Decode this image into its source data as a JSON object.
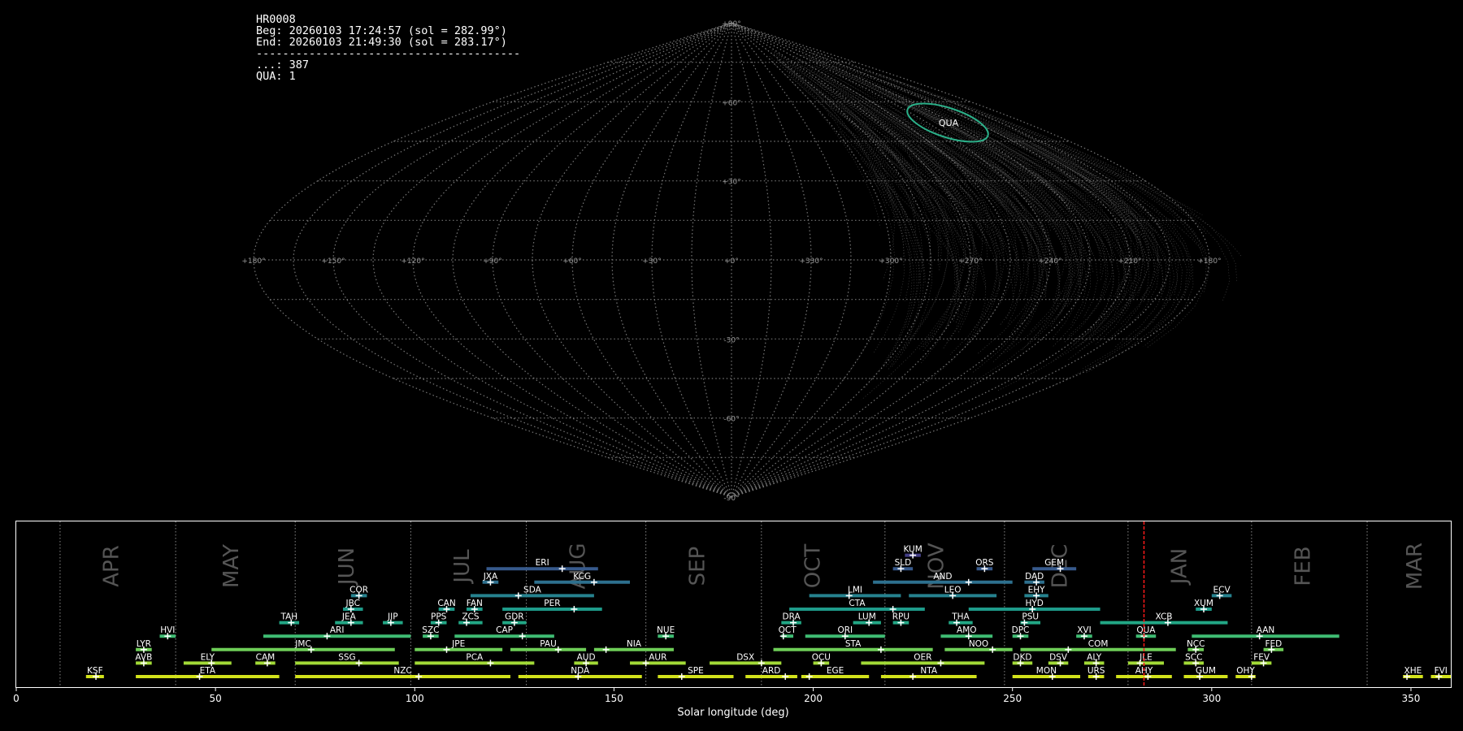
{
  "info": {
    "station": "HR0008",
    "beg": "Beg: 20260103 17:24:57 (sol = 282.99°)",
    "end": "End: 20260103 21:49:30 (sol = 283.17°)",
    "separator": "----------------------------------------",
    "count": "...: 387",
    "qua": "QUA: 1"
  },
  "sky_map": {
    "projection": "sinusoidal",
    "lon_labels": [
      "+180°",
      "+150°",
      "+120°",
      "+90°",
      "+60°",
      "+30°",
      "+0°",
      "+330°",
      "+300°",
      "+270°",
      "+240°",
      "+210°",
      "+180°"
    ],
    "lat_labels": [
      "+90°",
      "+60°",
      "+30°",
      "-30°",
      "-60°",
      "-90°"
    ],
    "grid_color": "#777777",
    "highlight": {
      "label": "QUA",
      "color": "#2bb089"
    }
  },
  "chart_data": {
    "type": "gantt",
    "xlabel": "Solar longitude (deg)",
    "xlim": [
      0,
      360
    ],
    "xticks": [
      0,
      50,
      100,
      150,
      200,
      250,
      300,
      350
    ],
    "months": [
      {
        "name": "APR",
        "lon": 24
      },
      {
        "name": "MAY",
        "lon": 54
      },
      {
        "name": "JUN",
        "lon": 83
      },
      {
        "name": "JUL",
        "lon": 112
      },
      {
        "name": "AUG",
        "lon": 141
      },
      {
        "name": "SEP",
        "lon": 171
      },
      {
        "name": "OCT",
        "lon": 200
      },
      {
        "name": "NOV",
        "lon": 231
      },
      {
        "name": "DEC",
        "lon": 262
      },
      {
        "name": "JAN",
        "lon": 292
      },
      {
        "name": "FEB",
        "lon": 323
      },
      {
        "name": "MAR",
        "lon": 351
      }
    ],
    "month_dividers": [
      11,
      40,
      70,
      99,
      128,
      158,
      187,
      218,
      248,
      279,
      310,
      339
    ],
    "current_sol": 283.0,
    "showers": [
      {
        "code": "KSF",
        "start": 17.5,
        "end": 22,
        "peak": 20,
        "row": 0
      },
      {
        "code": "ETA",
        "start": 30,
        "end": 66,
        "peak": 46,
        "row": 0
      },
      {
        "code": "NZC",
        "start": 70,
        "end": 124,
        "peak": 101,
        "row": 0
      },
      {
        "code": "NDA",
        "start": 126,
        "end": 157,
        "peak": 141,
        "row": 0
      },
      {
        "code": "SPE",
        "start": 161,
        "end": 180,
        "peak": 167,
        "row": 0
      },
      {
        "code": "ARD",
        "start": 183,
        "end": 196,
        "peak": 193,
        "row": 0
      },
      {
        "code": "EGE",
        "start": 197,
        "end": 214,
        "peak": 199,
        "row": 0
      },
      {
        "code": "NTA",
        "start": 217,
        "end": 241,
        "peak": 225,
        "row": 0
      },
      {
        "code": "MON",
        "start": 250,
        "end": 267,
        "peak": 260,
        "row": 0
      },
      {
        "code": "URS",
        "start": 269,
        "end": 273,
        "peak": 271,
        "row": 0
      },
      {
        "code": "AHY",
        "start": 276,
        "end": 290,
        "peak": 284,
        "row": 0
      },
      {
        "code": "GUM",
        "start": 293,
        "end": 304,
        "peak": 297,
        "row": 0
      },
      {
        "code": "OHY",
        "start": 306,
        "end": 311,
        "peak": 310,
        "row": 0
      },
      {
        "code": "XHE",
        "start": 348,
        "end": 353,
        "peak": 349,
        "row": 0
      },
      {
        "code": "FVI",
        "start": 355,
        "end": 360,
        "peak": 357,
        "row": 0
      },
      {
        "code": "AVB",
        "start": 30,
        "end": 34,
        "peak": 32,
        "row": 1
      },
      {
        "code": "ELY",
        "start": 42,
        "end": 54,
        "peak": 49,
        "row": 1
      },
      {
        "code": "CAM",
        "start": 60,
        "end": 65,
        "peak": 63,
        "row": 1
      },
      {
        "code": "SSG",
        "start": 70,
        "end": 96,
        "peak": 86,
        "row": 1
      },
      {
        "code": "PCA",
        "start": 100,
        "end": 130,
        "peak": 119,
        "row": 1
      },
      {
        "code": "AUD",
        "start": 140,
        "end": 146,
        "peak": 143,
        "row": 1
      },
      {
        "code": "AUR",
        "start": 154,
        "end": 168,
        "peak": 158,
        "row": 1
      },
      {
        "code": "DSX",
        "start": 174,
        "end": 192,
        "peak": 187,
        "row": 1
      },
      {
        "code": "OCU",
        "start": 200,
        "end": 204,
        "peak": 202,
        "row": 1
      },
      {
        "code": "OER",
        "start": 212,
        "end": 243,
        "peak": 232,
        "row": 1
      },
      {
        "code": "DKD",
        "start": 250,
        "end": 255,
        "peak": 252,
        "row": 1
      },
      {
        "code": "DSV",
        "start": 259,
        "end": 264,
        "peak": 262,
        "row": 1
      },
      {
        "code": "ALY",
        "start": 268,
        "end": 273,
        "peak": 271,
        "row": 1
      },
      {
        "code": "JLE",
        "start": 279,
        "end": 288,
        "peak": 282,
        "row": 1
      },
      {
        "code": "SCC",
        "start": 293,
        "end": 298,
        "peak": 296,
        "row": 1
      },
      {
        "code": "FEV",
        "start": 310,
        "end": 315,
        "peak": 313,
        "row": 1
      },
      {
        "code": "LYR",
        "start": 30,
        "end": 34,
        "peak": 32,
        "row": 2
      },
      {
        "code": "JMC",
        "start": 49,
        "end": 95,
        "peak": 74,
        "row": 2
      },
      {
        "code": "JPE",
        "start": 100,
        "end": 122,
        "peak": 108,
        "row": 2
      },
      {
        "code": "PAU",
        "start": 124,
        "end": 143,
        "peak": 136,
        "row": 2
      },
      {
        "code": "NIA",
        "start": 145,
        "end": 165,
        "peak": 148,
        "row": 2
      },
      {
        "code": "STA",
        "start": 190,
        "end": 230,
        "peak": 217,
        "row": 2
      },
      {
        "code": "NOO",
        "start": 233,
        "end": 250,
        "peak": 245,
        "row": 2
      },
      {
        "code": "COM",
        "start": 252,
        "end": 291,
        "peak": 264,
        "row": 2
      },
      {
        "code": "NCC",
        "start": 294,
        "end": 298,
        "peak": 296,
        "row": 2
      },
      {
        "code": "FED",
        "start": 313,
        "end": 318,
        "peak": 315,
        "row": 2
      },
      {
        "code": "HVI",
        "start": 36,
        "end": 40,
        "peak": 38,
        "row": 3
      },
      {
        "code": "ARI",
        "start": 62,
        "end": 99,
        "peak": 78,
        "row": 3
      },
      {
        "code": "SZC",
        "start": 102,
        "end": 106,
        "peak": 104,
        "row": 3
      },
      {
        "code": "CAP",
        "start": 110,
        "end": 135,
        "peak": 127,
        "row": 3
      },
      {
        "code": "NUE",
        "start": 161,
        "end": 165,
        "peak": 163,
        "row": 3
      },
      {
        "code": "OCT",
        "start": 192,
        "end": 195,
        "peak": 192.5,
        "row": 3
      },
      {
        "code": "ORI",
        "start": 198,
        "end": 218,
        "peak": 208,
        "row": 3
      },
      {
        "code": "AMO",
        "start": 232,
        "end": 245,
        "peak": 239,
        "row": 3
      },
      {
        "code": "DPC",
        "start": 250,
        "end": 254,
        "peak": 252,
        "row": 3
      },
      {
        "code": "XVI",
        "start": 266,
        "end": 270,
        "peak": 268,
        "row": 3
      },
      {
        "code": "QUA",
        "start": 281,
        "end": 286,
        "peak": 283,
        "row": 3
      },
      {
        "code": "AAN",
        "start": 295,
        "end": 332,
        "peak": 312,
        "row": 3
      },
      {
        "code": "TAH",
        "start": 66,
        "end": 71,
        "peak": 69,
        "row": 4
      },
      {
        "code": "JEA",
        "start": 80,
        "end": 87,
        "peak": 84,
        "row": 4
      },
      {
        "code": "JIP",
        "start": 92,
        "end": 97,
        "peak": 94,
        "row": 4
      },
      {
        "code": "PPS",
        "start": 104,
        "end": 108,
        "peak": 106,
        "row": 4
      },
      {
        "code": "ZCS",
        "start": 111,
        "end": 117,
        "peak": 113,
        "row": 4
      },
      {
        "code": "GDR",
        "start": 122,
        "end": 128,
        "peak": 125,
        "row": 4
      },
      {
        "code": "DRA",
        "start": 192,
        "end": 197,
        "peak": 195,
        "row": 4
      },
      {
        "code": "LUM",
        "start": 210,
        "end": 217,
        "peak": 214,
        "row": 4
      },
      {
        "code": "RPU",
        "start": 220,
        "end": 224,
        "peak": 222,
        "row": 4
      },
      {
        "code": "THA",
        "start": 234,
        "end": 240,
        "peak": 236,
        "row": 4
      },
      {
        "code": "PSU",
        "start": 252,
        "end": 257,
        "peak": 253,
        "row": 4
      },
      {
        "code": "XCB",
        "start": 272,
        "end": 304,
        "peak": 289,
        "row": 4
      },
      {
        "code": "JBC",
        "start": 82,
        "end": 87,
        "peak": 84,
        "row": 5
      },
      {
        "code": "CAN",
        "start": 106,
        "end": 110,
        "peak": 108,
        "row": 5
      },
      {
        "code": "FAN",
        "start": 113,
        "end": 117,
        "peak": 115,
        "row": 5
      },
      {
        "code": "PER",
        "start": 122,
        "end": 147,
        "peak": 140,
        "row": 5
      },
      {
        "code": "CTA",
        "start": 194,
        "end": 228,
        "peak": 220,
        "row": 5
      },
      {
        "code": "HYD",
        "start": 239,
        "end": 272,
        "peak": 255,
        "row": 5
      },
      {
        "code": "XUM",
        "start": 296,
        "end": 300,
        "peak": 298,
        "row": 5
      },
      {
        "code": "COR",
        "start": 84,
        "end": 88,
        "peak": 86,
        "row": 6
      },
      {
        "code": "SDA",
        "start": 114,
        "end": 145,
        "peak": 126,
        "row": 6
      },
      {
        "code": "LMI",
        "start": 199,
        "end": 222,
        "peak": 209,
        "row": 6
      },
      {
        "code": "LEO",
        "start": 224,
        "end": 246,
        "peak": 235,
        "row": 6
      },
      {
        "code": "EHY",
        "start": 253,
        "end": 259,
        "peak": 256,
        "row": 6
      },
      {
        "code": "ECV",
        "start": 300,
        "end": 305,
        "peak": 302,
        "row": 6
      },
      {
        "code": "JXA",
        "start": 117,
        "end": 121,
        "peak": 119,
        "row": 7
      },
      {
        "code": "KCG",
        "start": 130,
        "end": 154,
        "peak": 145,
        "row": 7
      },
      {
        "code": "AND",
        "start": 215,
        "end": 250,
        "peak": 239,
        "row": 7
      },
      {
        "code": "DAD",
        "start": 253,
        "end": 258,
        "peak": 256,
        "row": 7
      },
      {
        "code": "ERI",
        "start": 118,
        "end": 146,
        "peak": 137,
        "row": 8
      },
      {
        "code": "SLD",
        "start": 220,
        "end": 225,
        "peak": 222,
        "row": 8
      },
      {
        "code": "ORS",
        "start": 241,
        "end": 245,
        "peak": 243,
        "row": 8
      },
      {
        "code": "GEM",
        "start": 255,
        "end": 266,
        "peak": 262,
        "row": 8
      },
      {
        "code": "KUM",
        "start": 223,
        "end": 227,
        "peak": 225,
        "row": 9
      }
    ]
  }
}
